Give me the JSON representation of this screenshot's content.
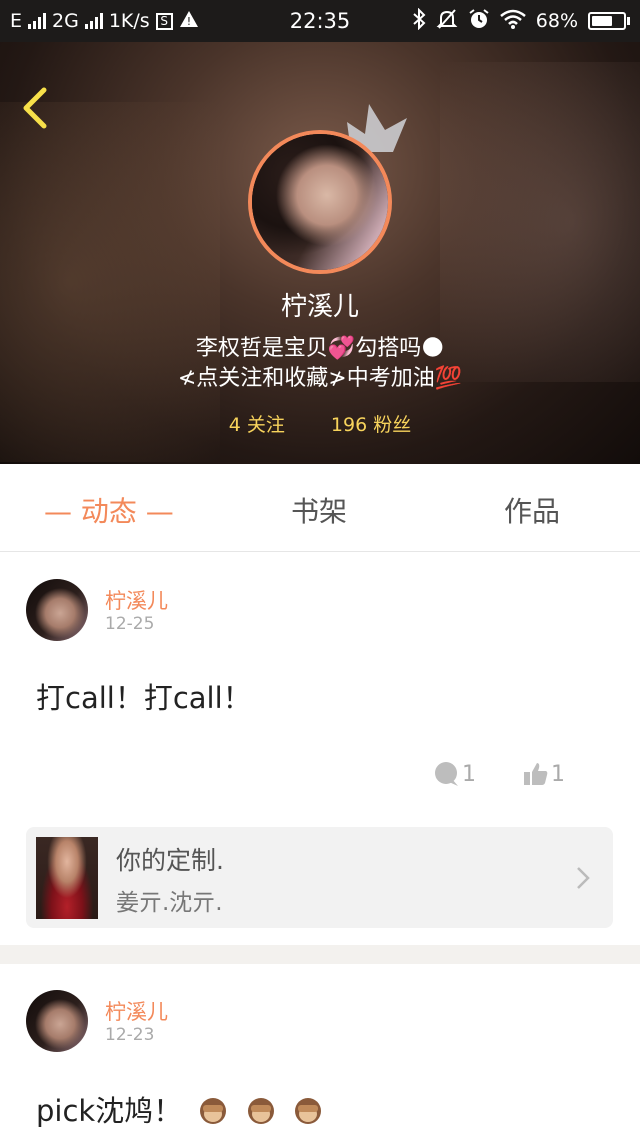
{
  "status_bar": {
    "left_text": "E",
    "network": "2G",
    "speed": "1K/s",
    "s_box": "S",
    "warning": "!",
    "time": "22:35",
    "battery": "68%",
    "battery_level": 0.68
  },
  "profile": {
    "name": "柠溪儿",
    "bio_line1": "李权哲是宝贝💞勾搭吗🌑",
    "bio_line2": "≮点关注和收藏≯中考加油💯",
    "following": "4 关注",
    "followers": "196 粉丝"
  },
  "tabs": [
    {
      "label": "— 动态 —",
      "active": true
    },
    {
      "label": "书架",
      "active": false
    },
    {
      "label": "作品",
      "active": false
    }
  ],
  "posts": [
    {
      "author": "柠溪儿",
      "date": "12-25",
      "text": "打call！打call！",
      "comments": "1",
      "likes": "1",
      "card": {
        "title": "你的定制.",
        "subtitle": "姜亓.沈亓."
      }
    },
    {
      "author": "柠溪儿",
      "date": "12-23",
      "text": "pick沈鸠！"
    }
  ],
  "colors": {
    "accent": "#f3895a",
    "stats_yellow": "#f7d35c",
    "back_arrow": "#f7e04a"
  },
  "icons": {
    "back": "chevron-left-icon",
    "crown": "crown-icon",
    "comment": "comment-bubble-icon",
    "like": "thumbs-up-icon",
    "card_arrow": "chevron-right-icon",
    "emoji": "see-no-evil-monkey-icon"
  }
}
